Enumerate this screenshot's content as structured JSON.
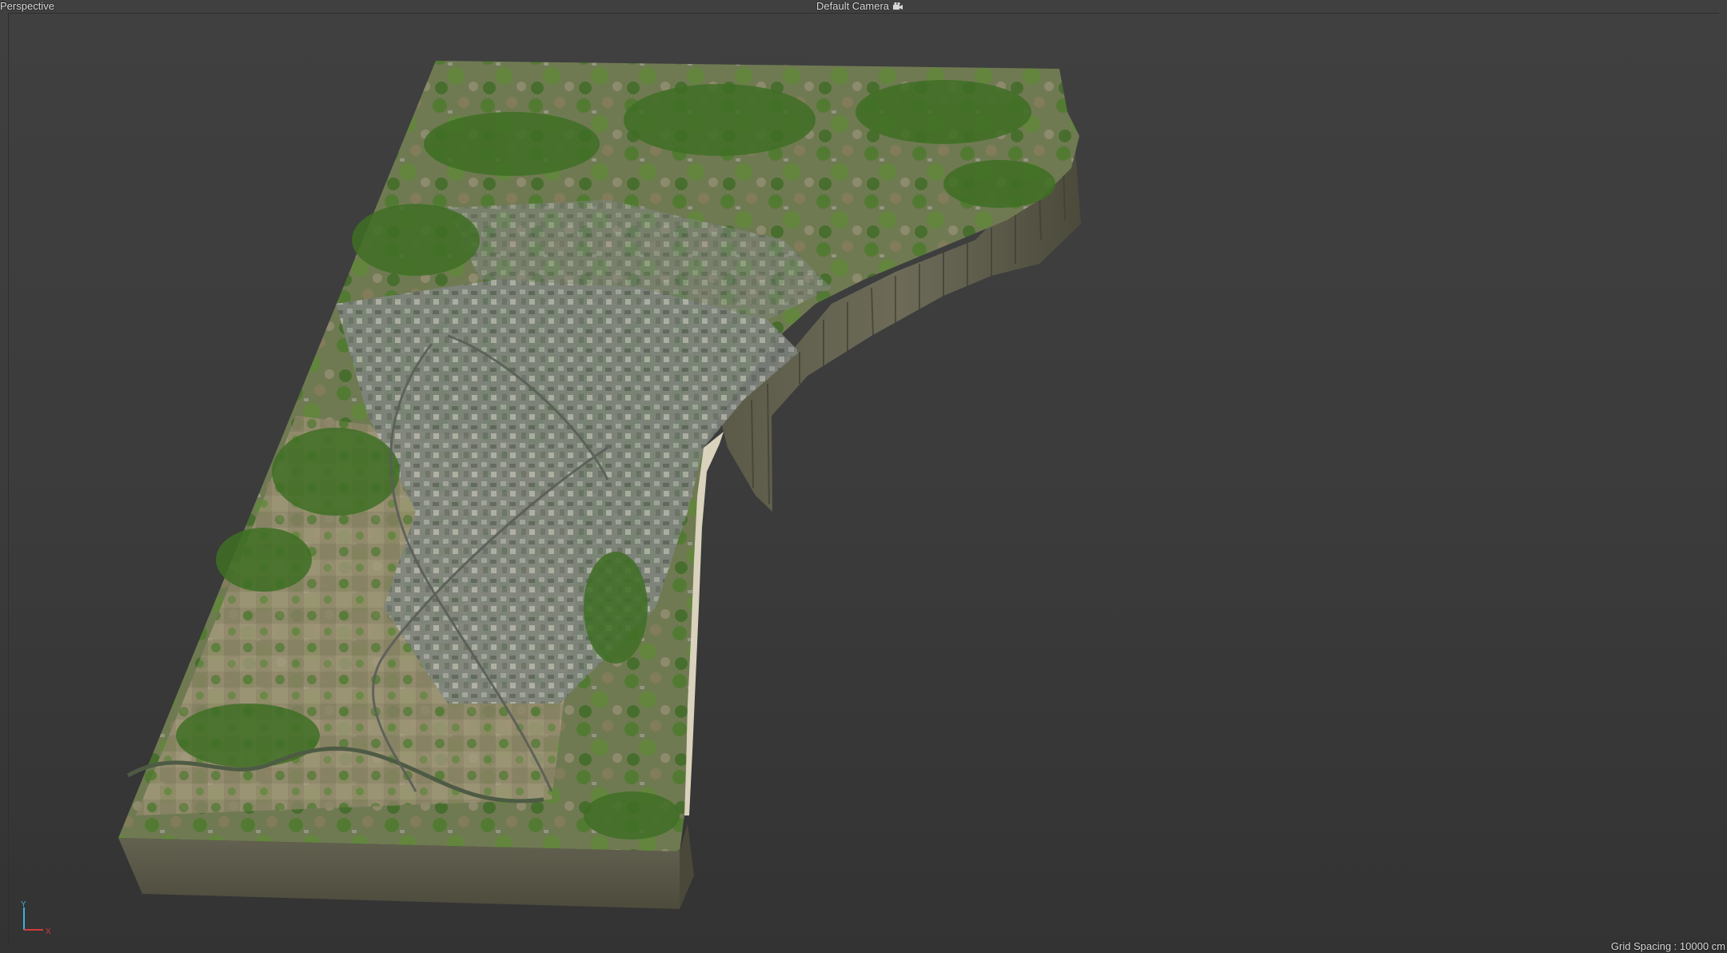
{
  "viewport": {
    "view_name": "Perspective",
    "camera_label": "Default Camera",
    "camera_icon": "camera-icon",
    "grid_spacing": "Grid Spacing : 10000 cm"
  },
  "axis_gizmo": {
    "y_label": "Y",
    "x_label": "X"
  },
  "colors": {
    "background": "#3c3c3c",
    "terrain_side": "#5e5c4a",
    "terrain_side_dark": "#4a4839",
    "vegetation": "#4f7a2f",
    "urban": "#8a8f88",
    "axis_x": "#d23b3b",
    "axis_y": "#3fb1d9"
  }
}
